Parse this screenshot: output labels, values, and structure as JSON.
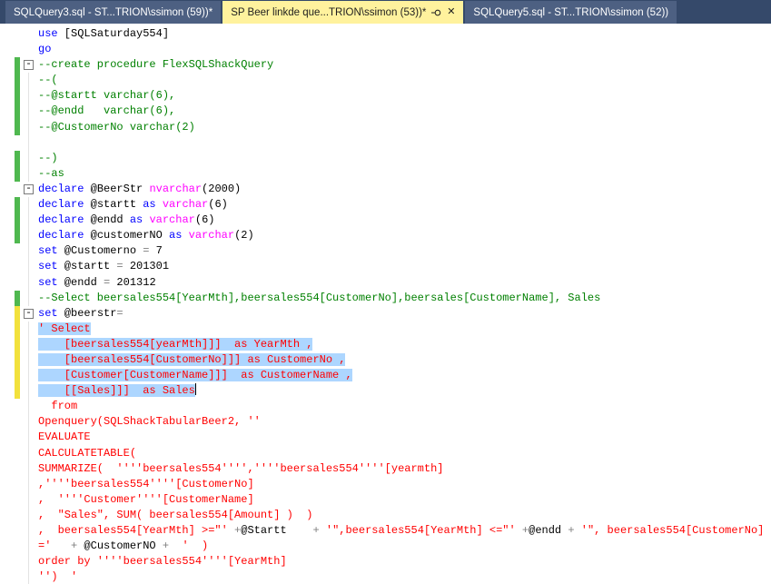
{
  "colors": {
    "tabbar_bg": "#35496a",
    "tab_inactive_bg": "#4d6082",
    "tab_active_bg": "#fff29d",
    "tab_active_text": "#1e1e1e",
    "editor_bg": "#ffffff",
    "keyword": "#0000ff",
    "comment": "#008000",
    "string": "#ff0000",
    "type": "#ff00ff",
    "operator": "#808080",
    "plain": "#000000",
    "selection": "#add6ff",
    "track_saved": "#4fb84f",
    "track_unsaved": "#f2e13c"
  },
  "icons": {
    "pin": "⚲",
    "close": "✕",
    "fold_collapse": "-"
  },
  "tabs": [
    {
      "label": "SQLQuery3.sql - ST...TRION\\ssimon (59))*",
      "active": false
    },
    {
      "label": "SP Beer linkde que...TRION\\ssimon (53))*",
      "active": true
    },
    {
      "label": "SQLQuery5.sql - ST...TRION\\ssimon (52))",
      "active": false
    }
  ],
  "editor": {
    "lines": [
      {
        "segs": [
          [
            "kw",
            "use"
          ],
          [
            "pl",
            " [SQLSaturday554]"
          ]
        ]
      },
      {
        "segs": [
          [
            "kw",
            "go"
          ]
        ]
      },
      {
        "fold": "box",
        "ind": "g",
        "segs": [
          [
            "cm",
            "--create procedure FlexSQLShackQuery"
          ]
        ]
      },
      {
        "fold": "guide",
        "ind": "g",
        "segs": [
          [
            "cm",
            "--("
          ]
        ]
      },
      {
        "fold": "guide",
        "ind": "g",
        "segs": [
          [
            "cm",
            "--@startt varchar(6),"
          ]
        ]
      },
      {
        "fold": "guide",
        "ind": "g",
        "segs": [
          [
            "cm",
            "--@endd   varchar(6),"
          ]
        ]
      },
      {
        "fold": "guide",
        "ind": "g",
        "segs": [
          [
            "cm",
            "--@CustomerNo varchar(2)"
          ]
        ]
      },
      {
        "fold": "guide",
        "segs": []
      },
      {
        "fold": "guide",
        "ind": "g",
        "segs": [
          [
            "cm",
            "--)"
          ]
        ]
      },
      {
        "fold": "guide",
        "ind": "g",
        "segs": [
          [
            "cm",
            "--as"
          ]
        ]
      },
      {
        "fold": "box",
        "segs": [
          [
            "kw",
            "declare"
          ],
          [
            "pl",
            " @BeerStr "
          ],
          [
            "ty",
            "nvarchar"
          ],
          [
            "pl",
            "(2000)"
          ]
        ]
      },
      {
        "fold": "guide",
        "ind": "g",
        "segs": [
          [
            "kw",
            "declare"
          ],
          [
            "pl",
            " @startt "
          ],
          [
            "kw",
            "as"
          ],
          [
            "pl",
            " "
          ],
          [
            "ty",
            "varchar"
          ],
          [
            "pl",
            "(6)"
          ]
        ]
      },
      {
        "fold": "guide",
        "ind": "g",
        "segs": [
          [
            "kw",
            "declare"
          ],
          [
            "pl",
            " @endd "
          ],
          [
            "kw",
            "as"
          ],
          [
            "pl",
            " "
          ],
          [
            "ty",
            "varchar"
          ],
          [
            "pl",
            "(6)"
          ]
        ]
      },
      {
        "fold": "guide",
        "ind": "g",
        "segs": [
          [
            "kw",
            "declare"
          ],
          [
            "pl",
            " @customerNO "
          ],
          [
            "kw",
            "as"
          ],
          [
            "pl",
            " "
          ],
          [
            "ty",
            "varchar"
          ],
          [
            "pl",
            "(2)"
          ]
        ]
      },
      {
        "fold": "guide",
        "segs": [
          [
            "kw",
            "set"
          ],
          [
            "pl",
            " @Customerno "
          ],
          [
            "op",
            "="
          ],
          [
            "pl",
            " 7"
          ]
        ]
      },
      {
        "fold": "guide",
        "segs": [
          [
            "kw",
            "set"
          ],
          [
            "pl",
            " @startt "
          ],
          [
            "op",
            "="
          ],
          [
            "pl",
            " 201301"
          ]
        ]
      },
      {
        "fold": "guide",
        "segs": [
          [
            "kw",
            "set"
          ],
          [
            "pl",
            " @endd "
          ],
          [
            "op",
            "="
          ],
          [
            "pl",
            " 201312"
          ]
        ]
      },
      {
        "fold": "guide",
        "ind": "g",
        "segs": [
          [
            "cm",
            "--Select beersales554[YearMth],beersales554[CustomerNo],beersales[CustomerName], Sales"
          ]
        ]
      },
      {
        "fold": "box",
        "ind": "y",
        "segs": [
          [
            "kw",
            "set"
          ],
          [
            "pl",
            " @beerstr"
          ],
          [
            "op",
            "="
          ]
        ]
      },
      {
        "fold": "guide",
        "ind": "y",
        "sel": true,
        "segs": [
          [
            "st",
            "' Select"
          ]
        ]
      },
      {
        "fold": "guide",
        "ind": "y",
        "sel": true,
        "segs": [
          [
            "st",
            "    [beersales554[yearMth]]]  as YearMth ,"
          ]
        ]
      },
      {
        "fold": "guide",
        "ind": "y",
        "sel": true,
        "segs": [
          [
            "st",
            "    [beersales554[CustomerNo]]] as CustomerNo ,"
          ]
        ]
      },
      {
        "fold": "guide",
        "ind": "y",
        "sel": true,
        "segs": [
          [
            "st",
            "    [Customer[CustomerName]]]  as CustomerName ,"
          ]
        ]
      },
      {
        "fold": "guide",
        "ind": "y",
        "sel": true,
        "caret": true,
        "segs": [
          [
            "st",
            "    [[Sales]]]  as Sales"
          ]
        ]
      },
      {
        "fold": "guide",
        "segs": [
          [
            "st",
            "  from"
          ]
        ]
      },
      {
        "fold": "guide",
        "segs": [
          [
            "st",
            "Openquery(SQLShackTabularBeer2, ''"
          ]
        ]
      },
      {
        "fold": "guide",
        "segs": [
          [
            "st",
            "EVALUATE"
          ]
        ]
      },
      {
        "fold": "guide",
        "segs": [
          [
            "st",
            "CALCULATETABLE("
          ]
        ]
      },
      {
        "fold": "guide",
        "segs": [
          [
            "st",
            "SUMMARIZE(  ''''beersales554'''',''''beersales554''''[yearmth]"
          ]
        ]
      },
      {
        "fold": "guide",
        "segs": [
          [
            "st",
            ",''''beersales554''''[CustomerNo]"
          ]
        ]
      },
      {
        "fold": "guide",
        "segs": [
          [
            "st",
            ",  ''''Customer''''[CustomerName]"
          ]
        ]
      },
      {
        "fold": "guide",
        "segs": [
          [
            "st",
            ",  \"Sales\", SUM( beersales554[Amount] )  )"
          ]
        ]
      },
      {
        "fold": "guide",
        "segs": [
          [
            "st",
            ",  beersales554[YearMth] >=\"' "
          ],
          [
            "op",
            "+"
          ],
          [
            "pl",
            "@Startt    "
          ],
          [
            "op",
            "+"
          ],
          [
            "st",
            " '\",beersales554[YearMth] <=\"' "
          ],
          [
            "op",
            "+"
          ],
          [
            "pl",
            "@endd "
          ],
          [
            "op",
            "+"
          ],
          [
            "st",
            " '\", beersales554[CustomerNo]"
          ]
        ]
      },
      {
        "fold": "guide",
        "segs": [
          [
            "st",
            "='   "
          ],
          [
            "op",
            "+"
          ],
          [
            "pl",
            " @CustomerNO "
          ],
          [
            "op",
            "+"
          ],
          [
            "st",
            "  '  )"
          ]
        ]
      },
      {
        "fold": "guide",
        "segs": [
          [
            "st",
            "order by ''''beersales554''''[YearMth]"
          ]
        ]
      },
      {
        "fold": "guide",
        "segs": [
          [
            "st",
            "'')  '"
          ]
        ]
      }
    ]
  }
}
